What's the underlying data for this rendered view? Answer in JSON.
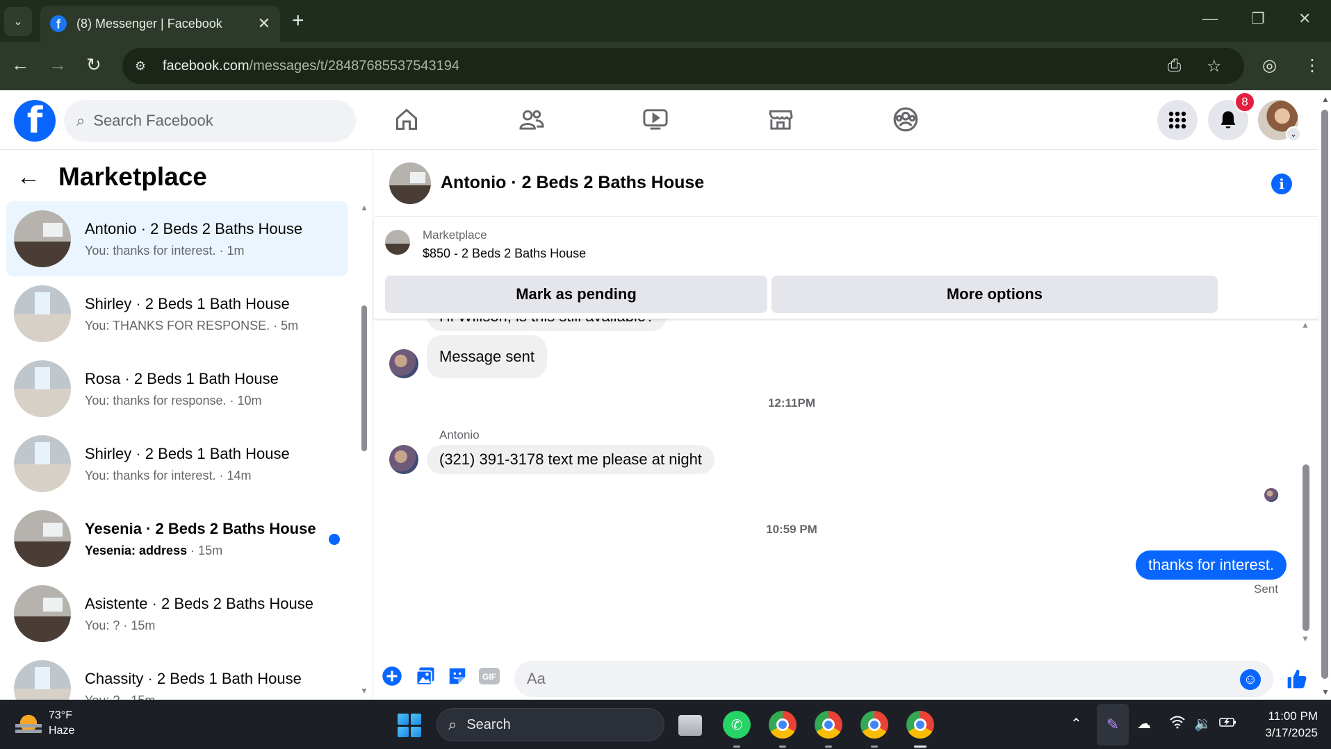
{
  "browser": {
    "tab_title": "(8) Messenger | Facebook",
    "url_host": "facebook.com",
    "url_path": "/messages/t/28487685537543194"
  },
  "facebook": {
    "search_placeholder": "Search Facebook",
    "notification_count": "8",
    "nav_icons": [
      "home-icon",
      "friends-icon",
      "video-icon",
      "marketplace-icon",
      "groups-icon"
    ]
  },
  "left_pane": {
    "title": "Marketplace",
    "conversations": [
      {
        "name": "Antonio · 2 Beds 2 Baths House",
        "snippet": "You: thanks for interest.",
        "time": "· 1m",
        "active": true,
        "unread": false
      },
      {
        "name": "Shirley · 2 Beds 1 Bath House",
        "snippet": "You: THANKS FOR RESPONSE.",
        "time": "· 5m",
        "active": false,
        "unread": false
      },
      {
        "name": "Rosa · 2 Beds 1 Bath House",
        "snippet": "You: thanks for response.",
        "time": "· 10m",
        "active": false,
        "unread": false
      },
      {
        "name": "Shirley · 2 Beds 1 Bath House",
        "snippet": "You: thanks for interest.",
        "time": "· 14m",
        "active": false,
        "unread": false
      },
      {
        "name": "Yesenia · 2 Beds 2 Baths House",
        "snippet": "Yesenia: address",
        "time": "· 15m",
        "active": false,
        "unread": true
      },
      {
        "name": "Asistente · 2 Beds 2 Baths House",
        "snippet": "You: ?",
        "time": "· 15m",
        "active": false,
        "unread": false
      },
      {
        "name": "Chassity · 2 Beds 1 Bath House",
        "snippet": "You: ?",
        "time": "· 15m",
        "active": false,
        "unread": false
      }
    ]
  },
  "chat": {
    "title": "Antonio · 2 Beds 2 Baths House",
    "listing_category": "Marketplace",
    "listing_title": "$850 - 2 Beds 2 Baths House",
    "mark_pending_label": "Mark as pending",
    "more_options_label": "More options",
    "messages": {
      "partial_incoming": "Hi Willson, is this still available?",
      "auto_reply": "Message sent",
      "timestamp_1": "12:11PM",
      "sender_name": "Antonio",
      "incoming_phone": "(321) 391-3178 text me please at night",
      "timestamp_2": "10:59 PM",
      "outgoing": "thanks for interest.",
      "sent_status": "Sent"
    },
    "composer_placeholder": "Aa",
    "gif_label": "GIF"
  },
  "taskbar": {
    "temperature": "73°F",
    "weather": "Haze",
    "search_label": "Search",
    "time": "11:00 PM",
    "date": "3/17/2025"
  }
}
